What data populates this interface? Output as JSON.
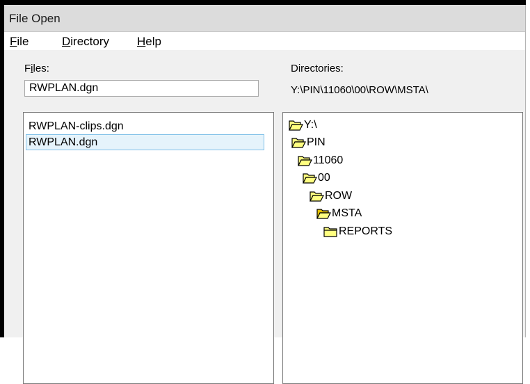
{
  "window": {
    "title": "File Open"
  },
  "menu": [
    {
      "label": "File",
      "mnemonic": "F",
      "rest": "ile"
    },
    {
      "label": "Directory",
      "mnemonic": "D",
      "rest": "irectory"
    },
    {
      "label": "Help",
      "mnemonic": "H",
      "rest": "elp"
    }
  ],
  "files": {
    "label_prefix": "F",
    "label_mnemonic": "i",
    "label_rest": "les:",
    "input_value": "RWPLAN.dgn",
    "items": [
      "RWPLAN-clips.dgn",
      "RWPLAN.dgn"
    ],
    "selected_index": 1
  },
  "directories": {
    "label": "Directories:",
    "current_path": "Y:\\PIN\\11060\\00\\ROW\\MSTA\\",
    "tree": [
      {
        "name": "Y:\\",
        "state": "open"
      },
      {
        "name": "PIN",
        "state": "open"
      },
      {
        "name": "11060",
        "state": "open"
      },
      {
        "name": "00",
        "state": "open"
      },
      {
        "name": "ROW",
        "state": "open"
      },
      {
        "name": "MSTA",
        "state": "open-current"
      },
      {
        "name": "REPORTS",
        "state": "closed"
      }
    ]
  },
  "colors": {
    "folder_fill": "#ffff80",
    "folder_current_fill": "#e6c300",
    "selection_bg": "#e5f3fb",
    "selection_border": "#7fc0e8"
  }
}
